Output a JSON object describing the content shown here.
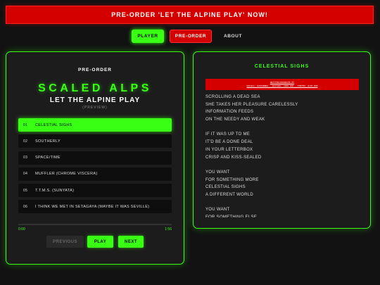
{
  "banner": {
    "text": "PRE-ORDER 'LET THE ALPINE PLAY' NOW!"
  },
  "nav": {
    "player": "PLAYER",
    "preorder": "PRE-ORDER",
    "about": "ABOUT"
  },
  "player": {
    "label": "PRE-ORDER",
    "artist": "SCALED ALPS",
    "album": "LET THE ALPINE PLAY",
    "preview": "(PREVIEW)",
    "tracks": [
      {
        "num": "01",
        "title": "CELESTIAL SIGHS"
      },
      {
        "num": "02",
        "title": "SOUTHERLY"
      },
      {
        "num": "03",
        "title": "SPACE/TIME"
      },
      {
        "num": "04",
        "title": "MUFFLER (CHROME VISCERA)"
      },
      {
        "num": "05",
        "title": "T.T.M.S. (SUNYATA)"
      },
      {
        "num": "06",
        "title": "I THINK WE MET IN SETAGAYA (MAYBE IT WAS SEVILLE)"
      }
    ],
    "active_track_index": 0,
    "progress_fraction": 0.0,
    "time_current": "0:00",
    "time_total": "1:56",
    "controls": {
      "prev": "PREVIOUS",
      "play": "PLAY",
      "next": "NEXT"
    }
  },
  "lyrics": {
    "title": "CELESTIAL SIGHS",
    "credit_line1": "WRITTEN/PRODUCED BY",
    "credit_line2": "VOCALS: ALEXANDRA · GUITARS: JOHN DOE · SYNTHS: ALEX DOE",
    "lines": [
      "SCROLLING A DEAD SEA",
      "SHE TAKES HER PLEASURE CARELESSLY",
      "INFORMATION FEEDS",
      "ON THE NEEDY AND WEAK",
      "",
      "IF IT WAS UP TO ME",
      "IT'D BE A DONE DEAL",
      "IN YOUR LETTERBOX",
      "CRISP AND KISS-SEALED",
      "",
      "YOU WANT",
      "FOR SOMETHING MORE",
      "CELESTIAL SIGHS",
      "A DIFFERENT WORLD",
      "",
      "YOU WANT",
      "FOR SOMETHING ELSE"
    ]
  },
  "colors": {
    "accent": "#39ff14",
    "alert": "#d40000",
    "background": "#121212",
    "panel": "#1c1c1c"
  }
}
